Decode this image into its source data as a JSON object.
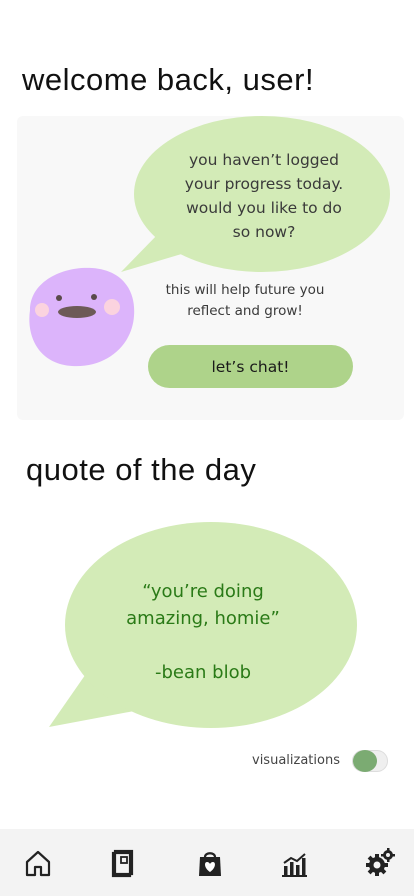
{
  "header": {
    "welcome_title": "welcome back, user!"
  },
  "chat_card": {
    "bubble_lines": [
      "you haven’t logged",
      "your progress today.",
      "would you like to do",
      "so now?"
    ],
    "helper_lines": [
      "this will help future you",
      "reflect and grow!"
    ],
    "button_label": "let’s chat!",
    "mascot": "bean-blob-icon"
  },
  "quote": {
    "section_title": "quote of the day",
    "text_lines": [
      "“you’re doing",
      "amazing, homie”"
    ],
    "author": "-bean blob"
  },
  "settings": {
    "visualizations_label": "visualizations",
    "visualizations_on": false
  },
  "bottom_nav": {
    "items": [
      {
        "name": "home",
        "icon": "home-icon"
      },
      {
        "name": "journal",
        "icon": "journal-icon"
      },
      {
        "name": "self-care",
        "icon": "heart-bag-icon"
      },
      {
        "name": "stats",
        "icon": "bar-chart-icon"
      },
      {
        "name": "settings",
        "icon": "gear-icon"
      }
    ]
  },
  "colors": {
    "bubble_green": "#d3ebb7",
    "button_green": "#aed38a",
    "quote_text_green": "#2a7a17",
    "blob_purple": "#dcb4fb",
    "toggle_green": "#7bab72"
  }
}
